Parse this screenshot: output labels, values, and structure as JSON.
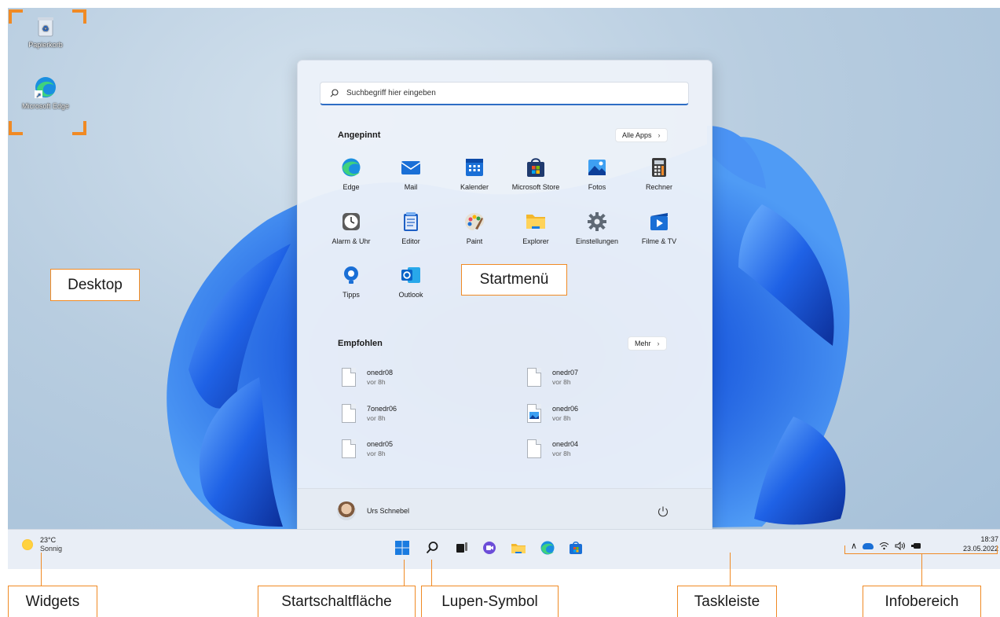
{
  "desktop": {
    "icons": [
      {
        "label": "Papierkorb"
      },
      {
        "label": "Microsoft Edge"
      }
    ]
  },
  "start_menu": {
    "search_placeholder": "Suchbegriff hier eingeben",
    "pinned_title": "Angepinnt",
    "all_apps_label": "Alle Apps",
    "pinned": [
      {
        "label": "Edge",
        "icon": "edge-icon"
      },
      {
        "label": "Mail",
        "icon": "mail-icon"
      },
      {
        "label": "Kalender",
        "icon": "calendar-icon"
      },
      {
        "label": "Microsoft Store",
        "icon": "store-icon"
      },
      {
        "label": "Fotos",
        "icon": "photos-icon"
      },
      {
        "label": "Rechner",
        "icon": "calculator-icon"
      },
      {
        "label": "Alarm & Uhr",
        "icon": "clock-icon"
      },
      {
        "label": "Editor",
        "icon": "notepad-icon"
      },
      {
        "label": "Paint",
        "icon": "paint-icon"
      },
      {
        "label": "Explorer",
        "icon": "folder-icon"
      },
      {
        "label": "Einstellungen",
        "icon": "gear-icon"
      },
      {
        "label": "Filme & TV",
        "icon": "movies-icon"
      },
      {
        "label": "Tipps",
        "icon": "tips-icon"
      },
      {
        "label": "Outlook",
        "icon": "outlook-icon"
      }
    ],
    "recommended_title": "Empfohlen",
    "more_label": "Mehr",
    "recommended": [
      {
        "name": "onedr08",
        "time": "vor 8h"
      },
      {
        "name": "onedr07",
        "time": "vor 8h"
      },
      {
        "name": "7onedr06",
        "time": "vor 8h"
      },
      {
        "name": "onedr06",
        "time": "vor 8h"
      },
      {
        "name": "onedr05",
        "time": "vor 8h"
      },
      {
        "name": "onedr04",
        "time": "vor 8h"
      }
    ],
    "user_name": "Urs Schnebel"
  },
  "taskbar": {
    "weather_temp": "23°C",
    "weather_text": "Sonnig",
    "time": "18:37",
    "date": "23.05.2022"
  },
  "callouts": {
    "desktop": "Desktop",
    "startmenu": "Startmenü",
    "widgets": "Widgets",
    "start_button": "Startschaltfläche",
    "search_icon": "Lupen-Symbol",
    "taskbar": "Taskleiste",
    "info_area": "Infobereich"
  },
  "colors": {
    "accent": "#0a6cd8",
    "callout_border": "#f08a24"
  }
}
